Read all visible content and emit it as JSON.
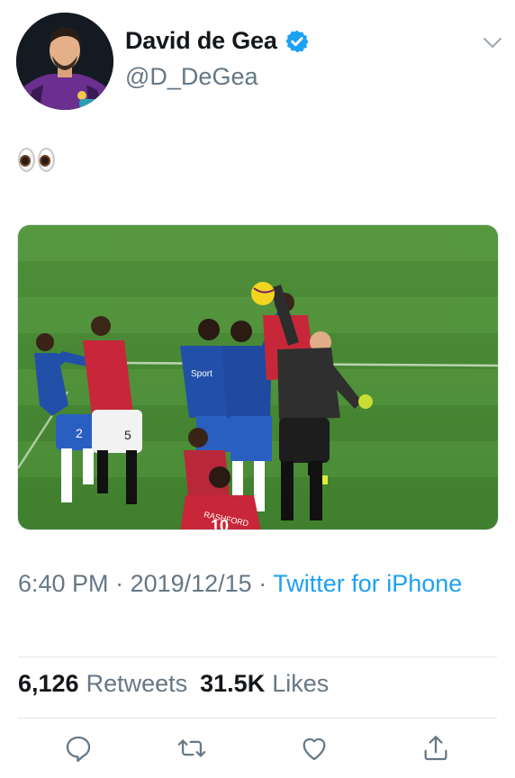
{
  "author": {
    "display_name": "David de Gea",
    "handle": "@D_DeGea",
    "verified": true,
    "avatar_icon": "profile-photo-goalkeeper"
  },
  "tweet": {
    "text_emoji": "eyes-emoji"
  },
  "media": {
    "type": "photo",
    "icon": "football-match-photo",
    "shirt_text": "RASHFORD",
    "shirt_number": "10",
    "sponsor_text": "Sport"
  },
  "meta": {
    "time": "6:40 PM",
    "separator": " · ",
    "date": "2019/12/15",
    "source": "Twitter for iPhone"
  },
  "stats": {
    "retweets_count": "6,126",
    "retweets_label": "Retweets",
    "likes_count": "31.5K",
    "likes_label": "Likes"
  },
  "actions": [
    {
      "name": "reply-icon"
    },
    {
      "name": "retweet-icon"
    },
    {
      "name": "like-icon"
    },
    {
      "name": "share-icon"
    }
  ],
  "colors": {
    "link": "#1da1f2",
    "secondary_text": "#657786",
    "primary_text": "#14171a",
    "verified": "#1da1f2"
  }
}
